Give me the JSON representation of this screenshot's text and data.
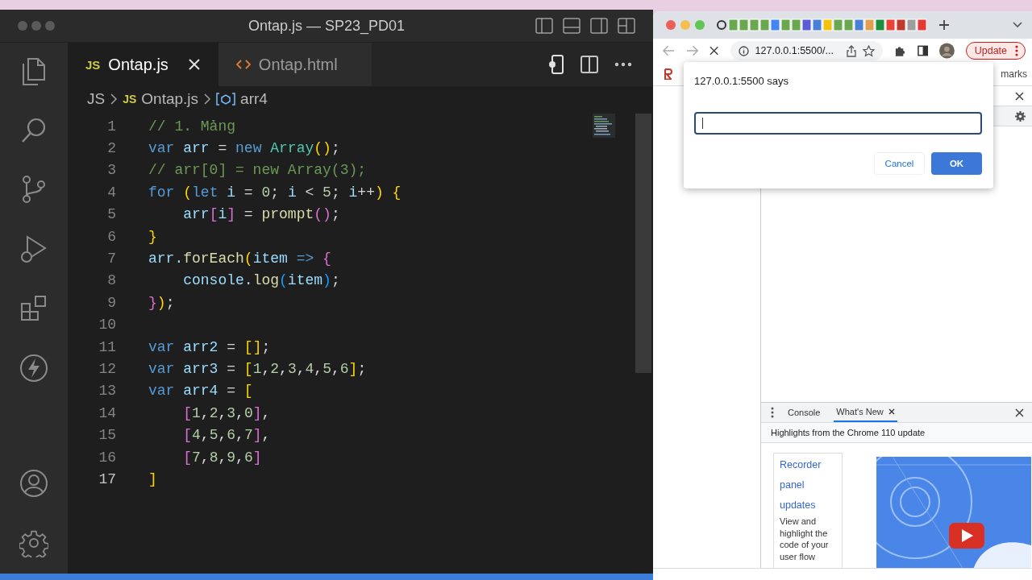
{
  "editor": {
    "title": "Ontap.js — SP23_PD01",
    "tabs": [
      {
        "label": "Ontap.js",
        "kind": "js",
        "icon_text": "JS",
        "selected": true
      },
      {
        "label": "Ontap.html",
        "kind": "html",
        "selected": false
      }
    ],
    "breadcrumb": {
      "folder": "JS",
      "file_icon_text": "JS",
      "file": "Ontap.js",
      "symbol": "arr4"
    },
    "lines": [
      {
        "number": "1",
        "active": false,
        "tokens": [
          {
            "t": "// 1. Mảng",
            "color": "#6a9955"
          }
        ]
      },
      {
        "number": "2",
        "active": false,
        "tokens": [
          {
            "t": "var ",
            "color": "#569cd6"
          },
          {
            "t": "arr",
            "color": "#9cdcfe"
          },
          {
            "t": " = ",
            "color": "#d4d4d4"
          },
          {
            "t": "new ",
            "color": "#569cd6"
          },
          {
            "t": "Array",
            "color": "#4ec9b0"
          },
          {
            "t": "()",
            "color": "#ffd700"
          },
          {
            "t": ";",
            "color": "#d4d4d4"
          }
        ]
      },
      {
        "number": "3",
        "active": false,
        "tokens": [
          {
            "t": "// arr[0] = new Array(3);",
            "color": "#6a9955"
          }
        ]
      },
      {
        "number": "4",
        "active": false,
        "tokens": [
          {
            "t": "for ",
            "color": "#569cd6"
          },
          {
            "t": "(",
            "color": "#ffd700"
          },
          {
            "t": "let ",
            "color": "#569cd6"
          },
          {
            "t": "i",
            "color": "#9cdcfe"
          },
          {
            "t": " = ",
            "color": "#d4d4d4"
          },
          {
            "t": "0",
            "color": "#b5cea8"
          },
          {
            "t": "; ",
            "color": "#d4d4d4"
          },
          {
            "t": "i",
            "color": "#9cdcfe"
          },
          {
            "t": " < ",
            "color": "#d4d4d4"
          },
          {
            "t": "5",
            "color": "#b5cea8"
          },
          {
            "t": "; ",
            "color": "#d4d4d4"
          },
          {
            "t": "i",
            "color": "#9cdcfe"
          },
          {
            "t": "++",
            "color": "#d4d4d4"
          },
          {
            "t": ") {",
            "color": "#ffd700"
          }
        ]
      },
      {
        "number": "5",
        "active": false,
        "tokens": [
          {
            "t": "    arr",
            "color": "#9cdcfe"
          },
          {
            "t": "[",
            "color": "#da70d6"
          },
          {
            "t": "i",
            "color": "#9cdcfe"
          },
          {
            "t": "]",
            "color": "#da70d6"
          },
          {
            "t": " = ",
            "color": "#d4d4d4"
          },
          {
            "t": "prompt",
            "color": "#dcdcaa"
          },
          {
            "t": "()",
            "color": "#da70d6"
          },
          {
            "t": ";",
            "color": "#d4d4d4"
          }
        ]
      },
      {
        "number": "6",
        "active": false,
        "tokens": [
          {
            "t": "}",
            "color": "#ffd700"
          }
        ]
      },
      {
        "number": "7",
        "active": false,
        "tokens": [
          {
            "t": "arr.",
            "color": "#9cdcfe"
          },
          {
            "t": "forEach",
            "color": "#dcdcaa"
          },
          {
            "t": "(",
            "color": "#ffd700"
          },
          {
            "t": "item ",
            "color": "#9cdcfe"
          },
          {
            "t": "=> ",
            "color": "#569cd6"
          },
          {
            "t": "{",
            "color": "#da70d6"
          }
        ]
      },
      {
        "number": "8",
        "active": false,
        "tokens": [
          {
            "t": "    console.",
            "color": "#9cdcfe"
          },
          {
            "t": "log",
            "color": "#dcdcaa"
          },
          {
            "t": "(",
            "color": "#179fff"
          },
          {
            "t": "item",
            "color": "#9cdcfe"
          },
          {
            "t": ")",
            "color": "#179fff"
          },
          {
            "t": ";",
            "color": "#d4d4d4"
          }
        ]
      },
      {
        "number": "9",
        "active": false,
        "tokens": [
          {
            "t": "}",
            "color": "#da70d6"
          },
          {
            "t": ")",
            "color": "#ffd700"
          },
          {
            "t": ";",
            "color": "#d4d4d4"
          }
        ]
      },
      {
        "number": "10",
        "active": false
      },
      {
        "number": "11",
        "active": false,
        "tokens": [
          {
            "t": "var ",
            "color": "#569cd6"
          },
          {
            "t": "arr2",
            "color": "#9cdcfe"
          },
          {
            "t": " = ",
            "color": "#d4d4d4"
          },
          {
            "t": "[]",
            "color": "#ffd700"
          },
          {
            "t": ";",
            "color": "#d4d4d4"
          }
        ]
      },
      {
        "number": "12",
        "active": false,
        "tokens": [
          {
            "t": "var ",
            "color": "#569cd6"
          },
          {
            "t": "arr3",
            "color": "#9cdcfe"
          },
          {
            "t": " = ",
            "color": "#d4d4d4"
          },
          {
            "t": "[",
            "color": "#ffd700"
          },
          {
            "t": "1",
            "color": "#b5cea8"
          },
          {
            "t": ",",
            "color": "#d4d4d4"
          },
          {
            "t": "2",
            "color": "#b5cea8"
          },
          {
            "t": ",",
            "color": "#d4d4d4"
          },
          {
            "t": "3",
            "color": "#b5cea8"
          },
          {
            "t": ",",
            "color": "#d4d4d4"
          },
          {
            "t": "4",
            "color": "#b5cea8"
          },
          {
            "t": ",",
            "color": "#d4d4d4"
          },
          {
            "t": "5",
            "color": "#b5cea8"
          },
          {
            "t": ",",
            "color": "#d4d4d4"
          },
          {
            "t": "6",
            "color": "#b5cea8"
          },
          {
            "t": "]",
            "color": "#ffd700"
          },
          {
            "t": ";",
            "color": "#d4d4d4"
          }
        ]
      },
      {
        "number": "13",
        "active": false,
        "tokens": [
          {
            "t": "var ",
            "color": "#569cd6"
          },
          {
            "t": "arr4",
            "color": "#9cdcfe"
          },
          {
            "t": " = ",
            "color": "#d4d4d4"
          },
          {
            "t": "[",
            "color": "#ffd700"
          }
        ]
      },
      {
        "number": "14",
        "active": false,
        "tokens": [
          {
            "t": "    [",
            "color": "#da70d6"
          },
          {
            "t": "1",
            "color": "#b5cea8"
          },
          {
            "t": ",",
            "color": "#d4d4d4"
          },
          {
            "t": "2",
            "color": "#b5cea8"
          },
          {
            "t": ",",
            "color": "#d4d4d4"
          },
          {
            "t": "3",
            "color": "#b5cea8"
          },
          {
            "t": ",",
            "color": "#d4d4d4"
          },
          {
            "t": "0",
            "color": "#b5cea8"
          },
          {
            "t": "]",
            "color": "#da70d6"
          },
          {
            "t": ",",
            "color": "#d4d4d4"
          }
        ]
      },
      {
        "number": "15",
        "active": false,
        "tokens": [
          {
            "t": "    [",
            "color": "#da70d6"
          },
          {
            "t": "4",
            "color": "#b5cea8"
          },
          {
            "t": ",",
            "color": "#d4d4d4"
          },
          {
            "t": "5",
            "color": "#b5cea8"
          },
          {
            "t": ",",
            "color": "#d4d4d4"
          },
          {
            "t": "6",
            "color": "#b5cea8"
          },
          {
            "t": ",",
            "color": "#d4d4d4"
          },
          {
            "t": "7",
            "color": "#b5cea8"
          },
          {
            "t": "]",
            "color": "#da70d6"
          },
          {
            "t": ",",
            "color": "#d4d4d4"
          }
        ]
      },
      {
        "number": "16",
        "active": false,
        "tokens": [
          {
            "t": "    [",
            "color": "#da70d6"
          },
          {
            "t": "7",
            "color": "#b5cea8"
          },
          {
            "t": ",",
            "color": "#d4d4d4"
          },
          {
            "t": "8",
            "color": "#b5cea8"
          },
          {
            "t": ",",
            "color": "#d4d4d4"
          },
          {
            "t": "9",
            "color": "#b5cea8"
          },
          {
            "t": ",",
            "color": "#d4d4d4"
          },
          {
            "t": "6",
            "color": "#b5cea8"
          },
          {
            "t": "]",
            "color": "#da70d6"
          }
        ]
      },
      {
        "number": "17",
        "active": true,
        "tokens": [
          {
            "t": "]",
            "color": "#ffd700"
          }
        ]
      }
    ]
  },
  "browser": {
    "address": "127.0.0.1:5500/...",
    "update_label": "Update",
    "bookmarks_text": "marks",
    "dialog": {
      "title": "127.0.0.1:5500 says",
      "buttons": [
        {
          "label": "Cancel",
          "kind": "secondary"
        },
        {
          "label": "OK",
          "kind": "primary"
        }
      ]
    },
    "devtools": {
      "tabs": [
        {
          "label": "Console",
          "selected": false
        },
        {
          "label": "What's New",
          "selected": true
        }
      ],
      "banner": "Highlights from the Chrome 110 update",
      "card": {
        "link": "Recorder panel updates",
        "text": "View and highlight the code of your user flow"
      }
    }
  }
}
